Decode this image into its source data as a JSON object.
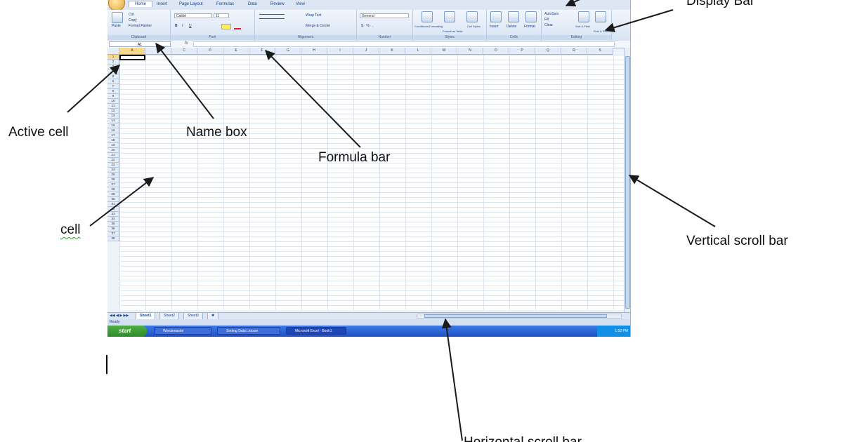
{
  "callouts": {
    "display_bar": "Display Bar",
    "active_cell": "Active cell",
    "name_box": "Name box",
    "formula_bar": "Formula bar",
    "cell": "cell",
    "vertical_scroll_bar": "Vertical scroll bar",
    "bottom_label": "Horizontal scroll bar"
  },
  "excel": {
    "tabs": [
      "Home",
      "Insert",
      "Page Layout",
      "Formulas",
      "Data",
      "Review",
      "View"
    ],
    "ribbon": {
      "paste": "Paste",
      "cut": "Cut",
      "copy": "Copy",
      "format_painter": "Format Painter",
      "font_name": "Calibri",
      "font_size": "11",
      "wrap_text": "Wrap Text",
      "merge_center": "Merge & Center",
      "number_format": "General",
      "conditional_formatting": "Conditional Formatting",
      "format_as_table": "Format as Table",
      "cell_styles": "Cell Styles",
      "insert": "Insert",
      "delete": "Delete",
      "format": "Format",
      "autosum": "AutoSum",
      "fill": "Fill",
      "clear": "Clear",
      "sort_filter": "Sort & Filter",
      "find_select": "Find & Select",
      "groups": [
        "Clipboard",
        "Font",
        "Alignment",
        "Number",
        "Styles",
        "Cells",
        "Editing"
      ]
    },
    "name_box": "A1",
    "fx": "fx",
    "columns": [
      "A",
      "B",
      "C",
      "D",
      "E",
      "F",
      "G",
      "H",
      "I",
      "J",
      "K",
      "L",
      "M",
      "N",
      "O",
      "P",
      "Q",
      "R",
      "S"
    ],
    "rows": [
      "1",
      "2",
      "3",
      "4",
      "5",
      "6",
      "7",
      "8",
      "9",
      "10",
      "11",
      "12",
      "13",
      "14",
      "15",
      "16",
      "17",
      "18",
      "19",
      "20",
      "21",
      "22",
      "23",
      "24",
      "25",
      "26",
      "27",
      "28",
      "29",
      "30",
      "31",
      "32",
      "33",
      "34",
      "35",
      "36",
      "37",
      "38"
    ],
    "sheets": [
      "Sheet1",
      "Sheet2",
      "Sheet3"
    ],
    "status": "Ready",
    "taskbar": {
      "start": "start",
      "items": [
        "Wordsmaster",
        "Sorting Data Lesson",
        "Microsoft Excel - Book1"
      ],
      "clock": "1:52 PM"
    }
  },
  "colors": {
    "arrow": "#1a1a1a",
    "active_header": "#f9d98d",
    "taskbar": "#2a5fd6"
  }
}
